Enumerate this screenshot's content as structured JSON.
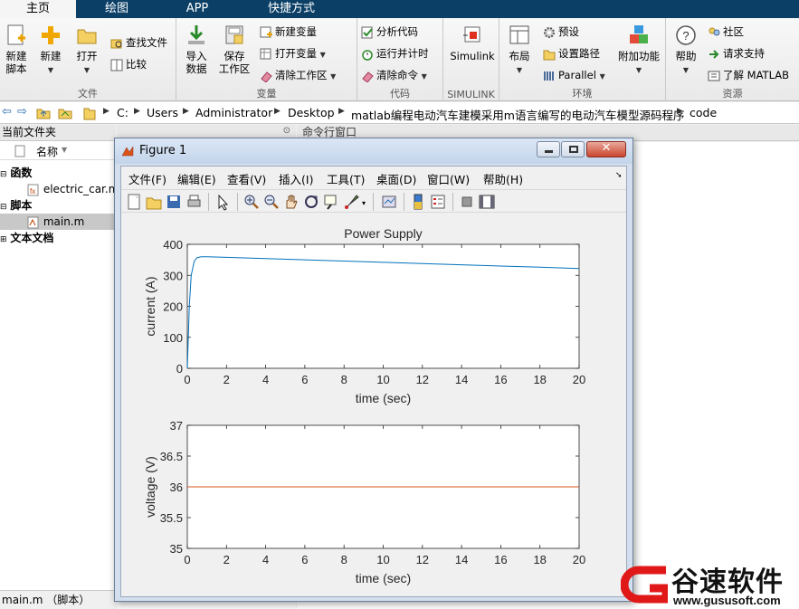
{
  "tabs": [
    {
      "label": "主页",
      "active": true
    },
    {
      "label": "绘图",
      "active": false
    },
    {
      "label": "APP",
      "active": false
    },
    {
      "label": "快捷方式",
      "active": false
    }
  ],
  "ribbon": {
    "file": {
      "label": "文件",
      "new_script": "新建\n脚本",
      "new": "新建",
      "open": "打开",
      "find_files": "查找文件",
      "compare": "比较"
    },
    "variable": {
      "label": "变量",
      "import": "导入\n数据",
      "save_ws": "保存\n工作区",
      "new_var": "新建变量",
      "open_var": "打开变量",
      "clear_ws": "清除工作区"
    },
    "code": {
      "label": "代码",
      "analyze": "分析代码",
      "run_time": "运行并计时",
      "clear_cmd": "清除命令"
    },
    "simulink": {
      "label": "SIMULINK",
      "simulink": "Simulink"
    },
    "env": {
      "label": "环境",
      "layout": "布局",
      "prefs": "预设",
      "set_path": "设置路径",
      "parallel": "Parallel",
      "addons": "附加功能"
    },
    "resources": {
      "label": "资源",
      "help": "帮助",
      "community": "社区",
      "support": "请求支持",
      "learn": "了解 MATLAB"
    }
  },
  "address": {
    "crumbs": [
      "C:",
      "Users",
      "Administrator",
      "Desktop",
      "matlab编程电动汽车建模采用m语言编写的电动汽车模型源码程序",
      "code"
    ]
  },
  "left_panel": {
    "title": "当前文件夹",
    "col_name": "名称",
    "groups": [
      {
        "label": "函数",
        "files": [
          "electric_car.m"
        ]
      },
      {
        "label": "脚本",
        "files": [
          "main.m"
        ]
      },
      {
        "label": "文本文档",
        "files": []
      }
    ],
    "status": "main.m （脚本）"
  },
  "cmd_window": {
    "title": "命令行窗口"
  },
  "figure": {
    "title": "Figure 1",
    "menus": [
      "文件(F)",
      "编辑(E)",
      "查看(V)",
      "插入(I)",
      "工具(T)",
      "桌面(D)",
      "窗口(W)",
      "帮助(H)"
    ]
  },
  "colors": {
    "accent": "#0b3f66",
    "series_current": "#0072bd",
    "series_voltage": "#d95319"
  },
  "chart_data": [
    {
      "type": "line",
      "title": "Power Supply",
      "xlabel": "time (sec)",
      "ylabel": "current (A)",
      "xlim": [
        0,
        20
      ],
      "ylim": [
        0,
        400
      ],
      "xticks": [
        0,
        2,
        4,
        6,
        8,
        10,
        12,
        14,
        16,
        18,
        20
      ],
      "yticks": [
        0,
        100,
        200,
        300,
        400
      ],
      "grid": false,
      "series": [
        {
          "x": [
            0,
            0.1,
            0.2,
            0.35,
            0.5,
            0.7,
            1,
            2,
            4,
            6,
            8,
            10,
            12,
            14,
            16,
            18,
            20
          ],
          "values": [
            0,
            200,
            300,
            345,
            357,
            360,
            360,
            358,
            354,
            350,
            346,
            342,
            338,
            334,
            330,
            326,
            322
          ]
        }
      ]
    },
    {
      "type": "line",
      "title": "",
      "xlabel": "time (sec)",
      "ylabel": "voltage (V)",
      "xlim": [
        0,
        20
      ],
      "ylim": [
        35,
        37
      ],
      "xticks": [
        0,
        2,
        4,
        6,
        8,
        10,
        12,
        14,
        16,
        18,
        20
      ],
      "yticks": [
        35,
        35.5,
        36,
        36.5,
        37
      ],
      "grid": false,
      "series": [
        {
          "x": [
            0,
            20
          ],
          "values": [
            36,
            36
          ]
        }
      ]
    }
  ],
  "watermark": {
    "brand": "谷速软件",
    "url": "www.gususoft.com"
  }
}
